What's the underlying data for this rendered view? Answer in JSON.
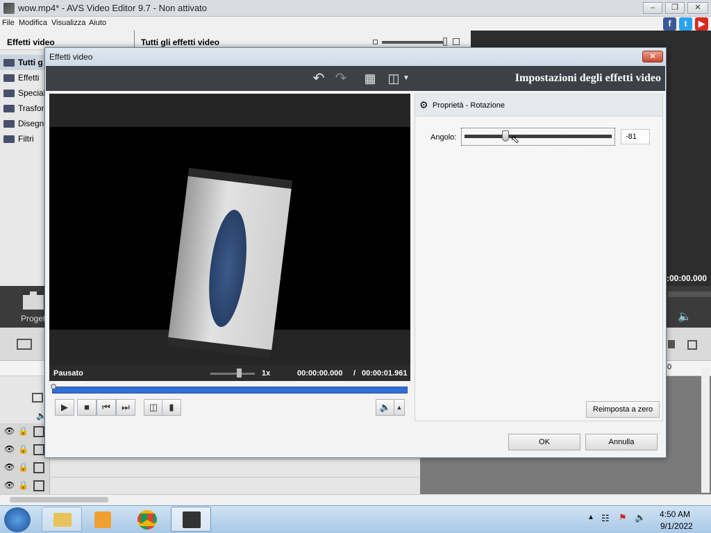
{
  "window": {
    "title": "wow.mp4* - AVS Video Editor 9.7 - Non attivato"
  },
  "menu": [
    "File",
    "Modifica",
    "Visualizza",
    "Aiuto"
  ],
  "left_panel": {
    "title": "Effetti video",
    "items": [
      "Tutti g",
      "Effetti",
      "Speciali",
      "Trasfor",
      "Disegno",
      "Filtri"
    ]
  },
  "content_header": {
    "title": "Tutti gli effetti video"
  },
  "background": {
    "time_display": ":00:00.000",
    "project_label": "Proget",
    "ruler_label": "0"
  },
  "dialog": {
    "title": "Effetti video",
    "heading": "Impostazioni degli effetti video",
    "player": {
      "status": "Pausato",
      "speed": "1x",
      "current_time": "00:00:00.000",
      "separator": "/",
      "total_time": "00:00:01.961"
    },
    "props": {
      "header": "Proprietà - Rotazione",
      "angle_label": "Angolo:",
      "angle_value": "-81",
      "reset_label": "Reimposta a zero"
    },
    "ok_label": "OK",
    "cancel_label": "Annulla"
  },
  "tray": {
    "time": "4:50 AM",
    "date": "9/1/2022"
  },
  "colors": {
    "accent": "#2f6fd6",
    "toolbar": "#3e4047"
  }
}
